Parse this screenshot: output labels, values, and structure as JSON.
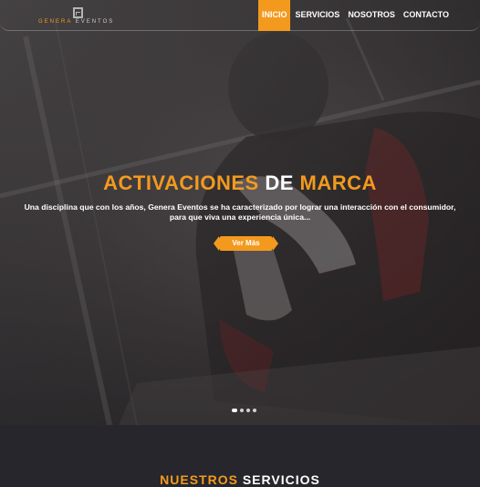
{
  "brand": {
    "logo_word1": "GENERA",
    "logo_word2": "EVENTOS",
    "accent_color": "#f39a1e"
  },
  "nav": {
    "items": [
      {
        "label": "INICIO",
        "active": true
      },
      {
        "label": "SERVICIOS",
        "active": false
      },
      {
        "label": "NOSOTROS",
        "active": false
      },
      {
        "label": "CONTACTO",
        "active": false
      }
    ]
  },
  "hero": {
    "title_part1": "ACTIVACIONES ",
    "title_part2": "DE",
    "title_part3": " MARCA",
    "description": "Una disciplina que con los años, Genera Eventos se ha caracterizado por lograr una interacción con el consumidor, para que viva una experiencia única...",
    "cta_label": "Ver Más",
    "slides_total": 4,
    "slide_active": 1
  },
  "section": {
    "title_part1": "NUESTROS",
    "title_part2": " SERVICIOS"
  }
}
